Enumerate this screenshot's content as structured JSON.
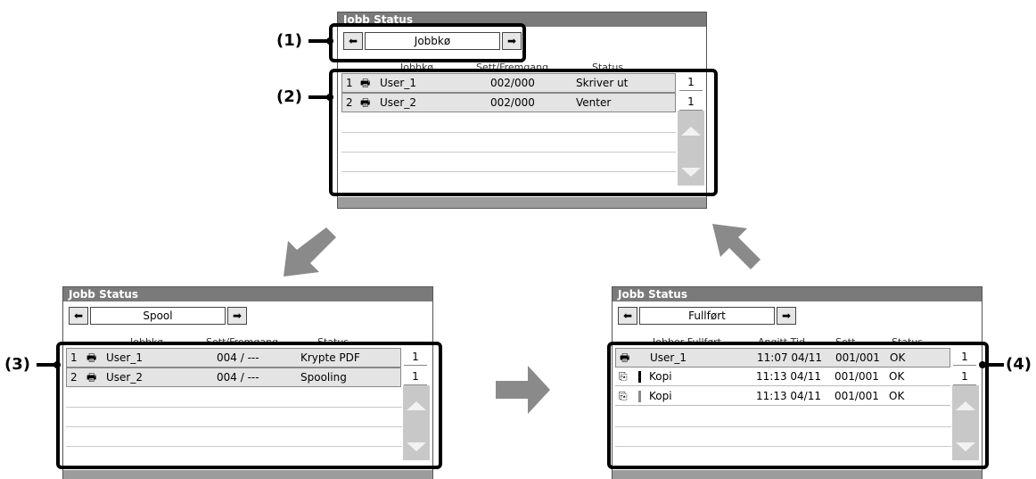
{
  "callouts": {
    "c1": "(1)",
    "c2": "(2)",
    "c3": "(3)",
    "c4": "(4)"
  },
  "top_panel": {
    "title": "Jobb Status",
    "tab": "Jobbkø",
    "headers": [
      "Jobbkø",
      "Sett/Fremgang",
      "Status"
    ],
    "rows": [
      {
        "num": "1",
        "user": "User_1",
        "progress": "002/000",
        "status": "Skriver ut",
        "page": "1"
      },
      {
        "num": "2",
        "user": "User_2",
        "progress": "002/000",
        "status": "Venter",
        "page": "1"
      }
    ]
  },
  "left_panel": {
    "title": "Jobb Status",
    "tab": "Spool",
    "headers": [
      "Jobbkø",
      "Sett/Fremgang",
      "Status"
    ],
    "rows": [
      {
        "num": "1",
        "user": "User_1",
        "progress": "004 / ---",
        "status": "Krypte PDF",
        "page": "1"
      },
      {
        "num": "2",
        "user": "User_2",
        "progress": "004 / ---",
        "status": "Spooling",
        "page": "1"
      }
    ]
  },
  "right_panel": {
    "title": "Jobb Status",
    "tab": "Fullført",
    "headers": [
      "Jobber Fullført",
      "Angitt Tid",
      "Sett",
      "Status"
    ],
    "rows": [
      {
        "name": "User_1",
        "time": "11:07 04/11",
        "sets": "001/001",
        "status": "OK",
        "page": "1"
      },
      {
        "name": "Kopi",
        "time": "11:13 04/11",
        "sets": "001/001",
        "status": "OK",
        "page": "1"
      },
      {
        "name": "Kopi",
        "time": "11:13 04/11",
        "sets": "001/001",
        "status": "OK"
      }
    ]
  },
  "icons": {
    "arrow_left": "left-arrow-icon",
    "arrow_right": "right-arrow-icon",
    "printer": "printer-job-icon",
    "copy": "copy-job-icon"
  },
  "colors": {
    "arrow": "#8a8a8a",
    "titlebar": "#7a7a7a",
    "row_fill": "#e4e4e4"
  }
}
